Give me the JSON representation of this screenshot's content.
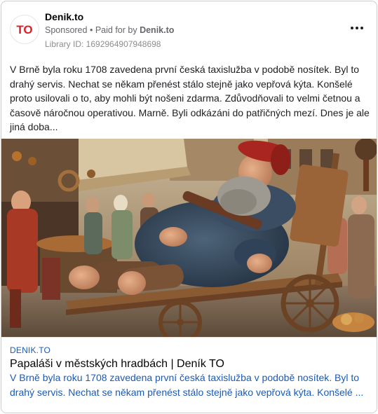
{
  "post": {
    "page_name": "Denik.to",
    "sponsored": "Sponsored",
    "separator": "•",
    "paid_for_by": "Paid for by",
    "payer": "Denik.to",
    "library_id": "Library ID: 1692964907948698",
    "logo_text": "TO",
    "body": "V Brně byla roku 1708 zavedena první česká taxislužba v podobě nosítek. Byl to drahý servis. Nechat se někam přenést stálo stejně jako vepřová kýta. Konšelé proto usilovali o to, aby mohli být nošeni zdarma. Zdůvodňovali to velmi četnou a časově náročnou operativou. Marně. Byli odkázáni do patřičných mezí. Dnes je ale jiná doba..."
  },
  "link": {
    "domain": "DENIK.TO",
    "title": "Papaláši v městských hradbách | Deník TO",
    "description": "V Brně byla roku 1708 zavedena první česká taxislužba v podobě nosítek. Byl to drahý servis. Nechat se někam přenést stálo stejně jako vepřová kýta. Konšelé ..."
  },
  "colors": {
    "brand_red": "#e11d27",
    "link_blue": "#1a5bb8",
    "meta_gray": "#65676b"
  },
  "icons": {
    "logo": "denik-to-logo-icon",
    "more": "more-options-icon"
  }
}
